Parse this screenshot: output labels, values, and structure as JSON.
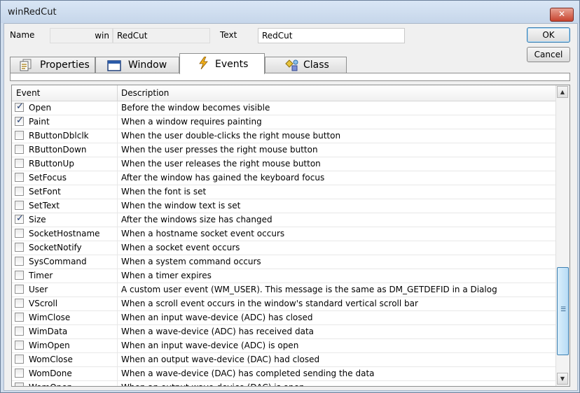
{
  "window": {
    "title": "winRedCut",
    "close_glyph": "✕"
  },
  "form": {
    "name_label": "Name",
    "name_prefix": "win",
    "name_value": "RedCut",
    "text_label": "Text",
    "text_value": "RedCut",
    "ok_label": "OK",
    "cancel_label": "Cancel"
  },
  "tabs": [
    {
      "label": "Properties",
      "icon": "properties-icon"
    },
    {
      "label": "Window",
      "icon": "window-icon"
    },
    {
      "label": "Events",
      "icon": "lightning-icon",
      "active": true
    },
    {
      "label": "Class",
      "icon": "class-icon"
    }
  ],
  "grid": {
    "headers": {
      "event": "Event",
      "description": "Description"
    },
    "rows": [
      {
        "event": "Open",
        "checked": true,
        "description": "Before the window becomes visible"
      },
      {
        "event": "Paint",
        "checked": true,
        "description": "When a window requires painting"
      },
      {
        "event": "RButtonDblclk",
        "checked": false,
        "description": "When the user double-clicks the right mouse button"
      },
      {
        "event": "RButtonDown",
        "checked": false,
        "description": "When the user presses the right mouse button"
      },
      {
        "event": "RButtonUp",
        "checked": false,
        "description": "When the user releases the right mouse button"
      },
      {
        "event": "SetFocus",
        "checked": false,
        "description": "After the window has gained the keyboard focus"
      },
      {
        "event": "SetFont",
        "checked": false,
        "description": "When the font is set"
      },
      {
        "event": "SetText",
        "checked": false,
        "description": "When the window text is set"
      },
      {
        "event": "Size",
        "checked": true,
        "description": "After the windows size has changed"
      },
      {
        "event": "SocketHostname",
        "checked": false,
        "description": "When a hostname socket event occurs"
      },
      {
        "event": "SocketNotify",
        "checked": false,
        "description": "When a socket event occurs"
      },
      {
        "event": "SysCommand",
        "checked": false,
        "description": "When a system command occurs"
      },
      {
        "event": "Timer",
        "checked": false,
        "description": "When a timer expires"
      },
      {
        "event": "User",
        "checked": false,
        "description": "A custom user event (WM_USER).  This message is the same as DM_GETDEFID in a Dialog"
      },
      {
        "event": "VScroll",
        "checked": false,
        "description": "When a scroll event occurs in the window's standard vertical scroll bar"
      },
      {
        "event": "WimClose",
        "checked": false,
        "description": "When an input wave-device (ADC) has closed"
      },
      {
        "event": "WimData",
        "checked": false,
        "description": "When a wave-device (ADC) has received data"
      },
      {
        "event": "WimOpen",
        "checked": false,
        "description": "When an input wave-device (ADC) is open"
      },
      {
        "event": "WomClose",
        "checked": false,
        "description": "When an output wave-device (DAC) had closed"
      },
      {
        "event": "WomDone",
        "checked": false,
        "description": "When a wave-device (DAC) has completed sending the data"
      },
      {
        "event": "WomOpen",
        "checked": false,
        "description": "When an output wave-device (DAC) is open"
      }
    ]
  },
  "scrollbar": {
    "up_glyph": "▲",
    "down_glyph": "▼",
    "grip_glyph": "☰"
  }
}
